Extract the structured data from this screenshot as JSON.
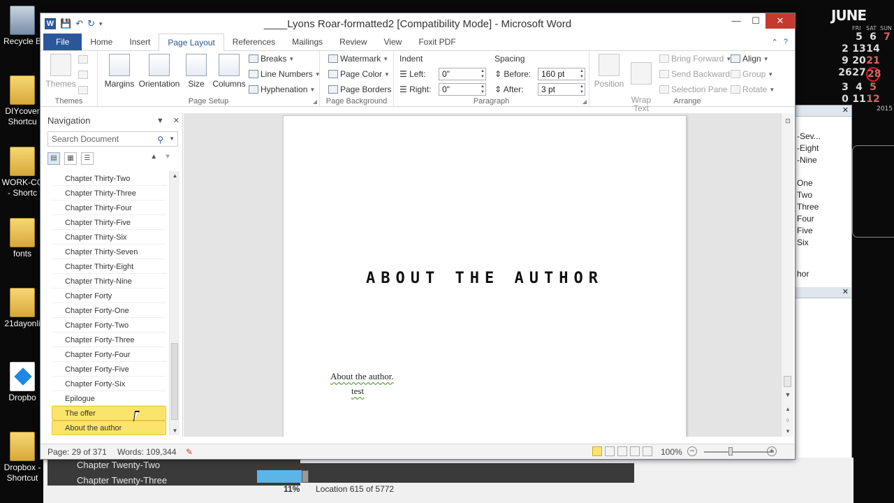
{
  "desktop": {
    "icons": [
      {
        "label": "Recycle B",
        "type": "recycle"
      },
      {
        "label": "DIYcover\nShortcu",
        "type": "folder"
      },
      {
        "label": "WORK-CC\n- Shortc",
        "type": "folder"
      },
      {
        "label": "fonts",
        "type": "folder"
      },
      {
        "label": "21dayonli",
        "type": "folder"
      },
      {
        "label": "Dropbo",
        "type": "dropbox"
      },
      {
        "label": "Dropbox -\nShortcut",
        "type": "folder"
      }
    ]
  },
  "calendar": {
    "month": "JUNE",
    "days": [
      "FRI",
      "SAT",
      "SUN"
    ],
    "rows": [
      [
        "",
        "",
        "5",
        "6",
        "7"
      ],
      [
        "",
        "2",
        "13",
        "14",
        ""
      ],
      [
        "",
        "9",
        "20",
        "21",
        ""
      ],
      [
        "",
        "26",
        "27",
        "28",
        ""
      ],
      [
        "",
        "3",
        "4",
        "5",
        ""
      ],
      [
        "",
        "0",
        "11",
        "12",
        ""
      ]
    ],
    "today": "28",
    "year": "2015"
  },
  "word": {
    "title": "____Lyons Roar-formatted2 [Compatibility Mode]  -  Microsoft Word",
    "qat_logo": "W",
    "window_controls": {
      "minimize": "—",
      "maximize": "☐",
      "close": "✕"
    },
    "tabs": [
      "File",
      "Home",
      "Insert",
      "Page Layout",
      "References",
      "Mailings",
      "Review",
      "View",
      "Foxit PDF"
    ],
    "active_tab": "Page Layout",
    "ribbon": {
      "themes": {
        "label": "Themes",
        "group": "Themes"
      },
      "page_setup": {
        "group": "Page Setup",
        "margins": "Margins",
        "orientation": "Orientation",
        "size": "Size",
        "columns": "Columns",
        "breaks": "Breaks",
        "line_numbers": "Line Numbers",
        "hyphenation": "Hyphenation"
      },
      "page_background": {
        "group": "Page Background",
        "watermark": "Watermark",
        "page_color": "Page Color",
        "page_borders": "Page Borders"
      },
      "paragraph": {
        "group": "Paragraph",
        "indent": "Indent",
        "left_label": "Left:",
        "left_value": "0\"",
        "right_label": "Right:",
        "right_value": "0\"",
        "spacing": "Spacing",
        "before_label": "Before:",
        "before_value": "160 pt",
        "after_label": "After:",
        "after_value": "3 pt"
      },
      "arrange": {
        "group": "Arrange",
        "position": "Position",
        "wrap_text": "Wrap\nText",
        "bring_forward": "Bring Forward",
        "send_backward": "Send Backward",
        "selection_pane": "Selection Pane",
        "align": "Align",
        "group_btn": "Group",
        "rotate": "Rotate"
      }
    },
    "navigation": {
      "title": "Navigation",
      "search_placeholder": "Search Document",
      "items": [
        "Chapter Thirty-Two",
        "Chapter Thirty-Three",
        "Chapter Thirty-Four",
        "Chapter Thirty-Five",
        "Chapter Thirty-Six",
        "Chapter Thirty-Seven",
        "Chapter Thirty-Eight",
        "Chapter Thirty-Nine",
        "Chapter Forty",
        "Chapter Forty-One",
        "Chapter Forty-Two",
        "Chapter Forty-Three",
        "Chapter Forty-Four",
        "Chapter Forty-Five",
        "Chapter Forty-Six",
        "Epilogue",
        "The offer",
        "About the author"
      ],
      "highlighted": [
        "The offer",
        "About the author"
      ]
    },
    "document": {
      "heading": "ABOUT THE AUTHOR",
      "line1": "About the author.",
      "line2": "test"
    },
    "status": {
      "page": "Page: 29 of 371",
      "words": "Words: 109,344",
      "zoom": "100%",
      "zoom_fraction": 0.5
    }
  },
  "right_panel": {
    "items_top": [
      "-Sev...",
      "-Eight",
      "-Nine"
    ],
    "items_mid": [
      "One",
      "Two",
      "Three",
      "Four",
      "Five",
      "Six"
    ],
    "item_bottom": "hor"
  },
  "reader": {
    "chapters": [
      "Chapter Twenty-Two",
      "Chapter Twenty-Three"
    ],
    "percent": "11%",
    "progress": 0.11,
    "location": "Location 615 of 5772"
  },
  "colors": {
    "accent": "#2b579a",
    "highlight": "#fbe46c",
    "close": "#c7392f",
    "today_ring": "#e02020"
  }
}
